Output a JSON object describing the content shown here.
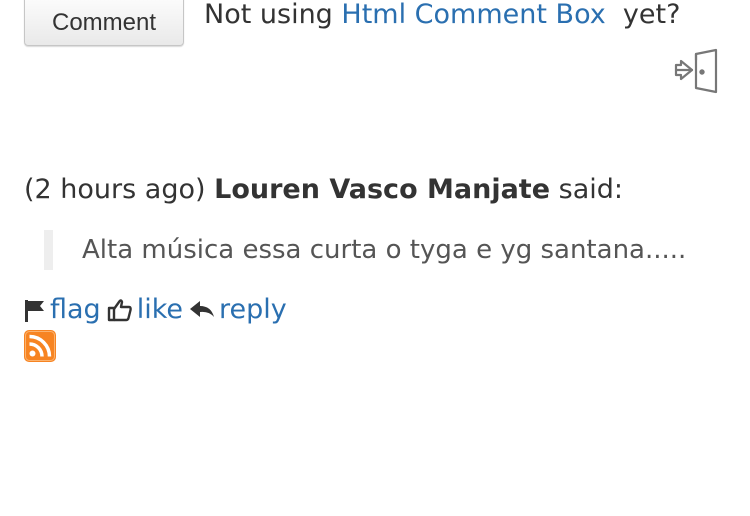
{
  "top": {
    "comment_button_label": "Comment",
    "promo_prefix": "Not using ",
    "promo_link": "Html Comment Box",
    "promo_suffix": "  yet?"
  },
  "comment": {
    "time": "(2 hours ago)",
    "author": "Louren Vasco Manjate",
    "said": "said:",
    "body": "Alta música essa curta o tyga e yg santana.....",
    "actions": {
      "flag": "flag",
      "like": "like",
      "reply": "reply"
    }
  },
  "colors": {
    "link": "#2a6fb0",
    "rss": "#f78422"
  },
  "icons": [
    "logout-icon",
    "flag-icon",
    "thumbs-up-icon",
    "reply-arrow-icon",
    "rss-icon"
  ]
}
